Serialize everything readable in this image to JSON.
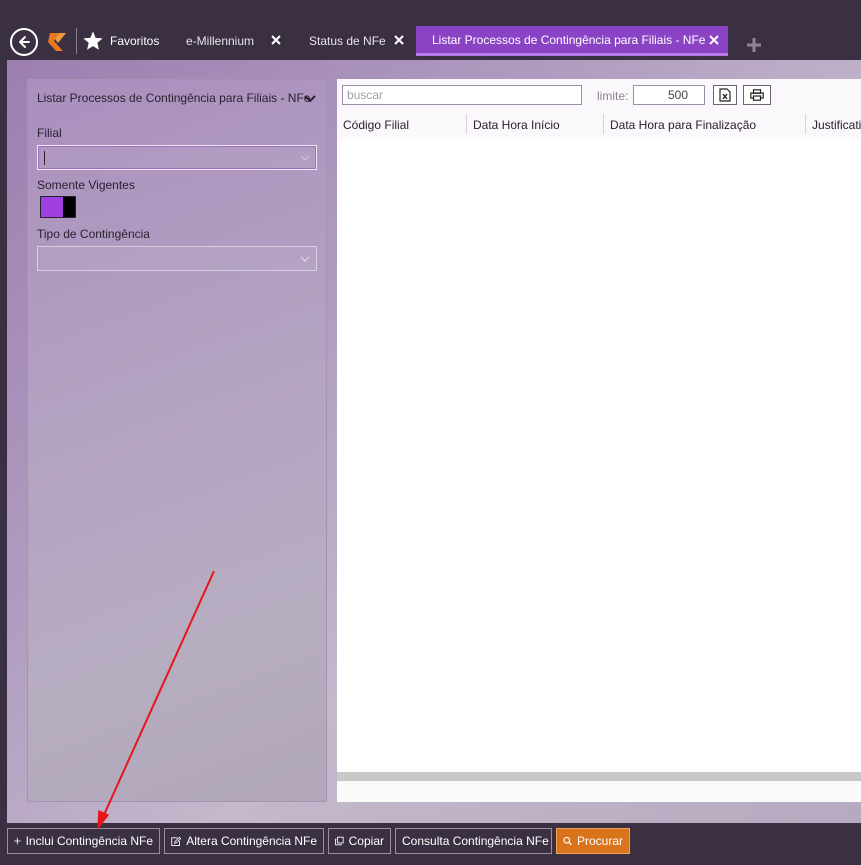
{
  "topbar": {
    "favorites_label": "Favoritos",
    "tabs": [
      {
        "label": "e-Millennium",
        "active": false
      },
      {
        "label": "Status de NFe",
        "active": false
      },
      {
        "label": "Listar Processos de Contingência para Filiais - NFe",
        "active": true
      }
    ]
  },
  "filter": {
    "title": "Listar Processos de Contingência para Filiais - NFe",
    "filial_label": "Filial",
    "filial_value": "",
    "somente_vigentes_label": "Somente Vigentes",
    "somente_vigentes_on": true,
    "tipo_label": "Tipo de Contingência",
    "tipo_value": ""
  },
  "results": {
    "search_placeholder": "buscar",
    "search_value": "",
    "limit_label": "limite:",
    "limit_value": "500",
    "columns": [
      "Código Filial",
      "Data Hora Início",
      "Data Hora para Finalização",
      "Justificati"
    ],
    "rows": []
  },
  "actions": {
    "inclui": "Inclui Contingência NFe",
    "altera": "Altera Contingência NFe",
    "copiar": "Copiar",
    "consulta": "Consulta Contingência NFe",
    "procurar": "Procurar"
  },
  "colors": {
    "active_tab": "#8a43c4",
    "accent_orange": "#d9741d",
    "toggle_on": "#a040e0",
    "annotation_arrow": "#e8141a"
  }
}
